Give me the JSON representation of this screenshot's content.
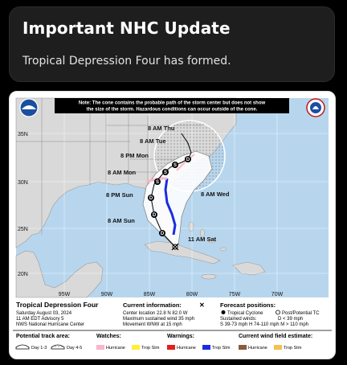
{
  "alert": {
    "title": "Important NHC Update",
    "message": "Tropical Depression Four has formed."
  },
  "graphic": {
    "note": "Note: The cone contains the probable path of the storm center but does not show the size of the storm. Hazardous conditions can occur outside of the cone.",
    "note_line1": "Note: The cone contains the probable path of the storm center but does not show",
    "note_line2": "the size of the storm. Hazardous conditions can occur outside of the cone.",
    "lat_labels": [
      "35N",
      "30N",
      "25N",
      "20N"
    ],
    "lon_labels": [
      "95W",
      "90W",
      "85W",
      "80W",
      "75W",
      "70W"
    ],
    "forecast_labels": {
      "thu": "8 AM Thu",
      "tue": "8 AM Tue",
      "mon_pm": "8 PM Mon",
      "mon_am": "8 AM Mon",
      "sun_pm": "8 PM Sun",
      "sun_am": "8 AM Sun",
      "sat": "11 AM Sat",
      "wed": "8 AM Wed"
    },
    "point_codes": [
      "D",
      "D",
      "D",
      "S",
      "S",
      "S",
      "D"
    ],
    "storm_name": "Tropical Depression Four",
    "date": "Saturday August 03, 2024",
    "advisory": "11 AM EDT Advisory 5",
    "center": "NWS National Hurricane Center",
    "current_title": "Current information:",
    "current_lines": [
      "Center location 22.8 N 82.0 W",
      "Maximum sustained wind 35 mph",
      "Movement WNW at 15 mph"
    ],
    "forecast_title": "Forecast positions:",
    "forecast_tc": "Tropical Cyclone",
    "forecast_ptc": "Post/Potential TC",
    "sustained": "Sustained winds:",
    "d_def": "D < 39 mph",
    "scale": "S 39-73 mph  H 74-110 mph  M > 110 mph",
    "track_title": "Potential track area:",
    "track_day13": "Day 1-3",
    "track_day45": "Day 4-5",
    "watches_title": "Watches:",
    "watch_hurricane": "Hurricane",
    "watch_trop": "Trop Stm",
    "warnings_title": "Warnings:",
    "warning_hurricane": "Hurricane",
    "warning_trop": "Trop Stm",
    "wind_title": "Current wind field estimate:",
    "wind_hurricane": "Hurricane",
    "wind_trop": "Trop Stm",
    "colors": {
      "ocean": "#b7d6ee",
      "land": "#d9d9d9",
      "watch_pink": "#f9b6c8",
      "trop_warning": "#1b2de0",
      "cone": "#ffffff",
      "track": "#000000"
    }
  }
}
